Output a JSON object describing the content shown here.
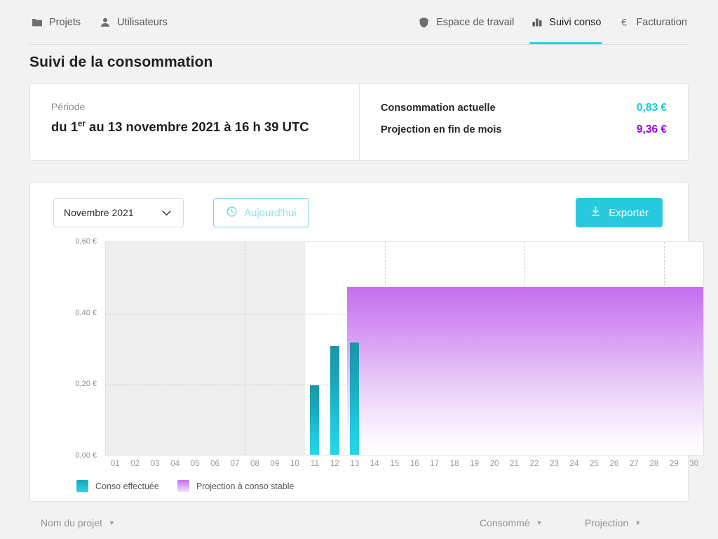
{
  "nav": {
    "left": [
      {
        "label": "Projets",
        "icon": "folder-icon"
      },
      {
        "label": "Utilisateurs",
        "icon": "user-icon"
      }
    ],
    "right": [
      {
        "label": "Espace de travail",
        "icon": "shield-icon",
        "active": false
      },
      {
        "label": "Suivi conso",
        "icon": "bar-chart-icon",
        "active": true
      },
      {
        "label": "Facturation",
        "icon": "euro-icon",
        "active": false
      }
    ],
    "active_underline_color": "#29d3e3"
  },
  "page": {
    "title": "Suivi de la consommation"
  },
  "summary": {
    "period_label": "Période",
    "period_prefix": "du 1",
    "period_sup": "er",
    "period_rest": " au 13 novembre 2021 à 16 h 39 UTC",
    "stats": [
      {
        "label": "Consommation actuelle",
        "value": "0,83 €",
        "color": "#18c8dd"
      },
      {
        "label": "Projection en fin de mois",
        "value": "9,36 €",
        "color": "#9a00d8"
      }
    ]
  },
  "toolbar": {
    "month_select": "Novembre 2021",
    "today_button": "Aujourd'hui",
    "export_button": "Exporter",
    "chevron_icon": "chevron-down-icon",
    "history_icon": "clock-rewind-icon",
    "download_icon": "download-icon"
  },
  "legend": [
    {
      "label": "Conso effectuée",
      "color": "#1fbed2"
    },
    {
      "label": "Projection à conso stable",
      "color": "#c071ef"
    }
  ],
  "table": {
    "columns": [
      {
        "label": "Nom du projet",
        "sort_icon": "sort-caret-icon"
      },
      {
        "label": "Consommé",
        "sort_icon": "sort-caret-icon"
      },
      {
        "label": "Projection",
        "sort_icon": "sort-caret-icon"
      }
    ]
  },
  "chart_data": {
    "type": "bar",
    "title": "",
    "xlabel": "",
    "ylabel": "",
    "categories": [
      "01",
      "02",
      "03",
      "04",
      "05",
      "06",
      "07",
      "08",
      "09",
      "10",
      "11",
      "12",
      "13",
      "14",
      "15",
      "16",
      "17",
      "18",
      "19",
      "20",
      "21",
      "22",
      "23",
      "24",
      "25",
      "26",
      "27",
      "28",
      "29",
      "30"
    ],
    "series": [
      {
        "name": "Conso effectuée",
        "color": "#1fbed2",
        "values": [
          null,
          null,
          null,
          null,
          null,
          null,
          null,
          null,
          null,
          null,
          0.195,
          0.305,
          0.315,
          null,
          null,
          null,
          null,
          null,
          null,
          null,
          null,
          null,
          null,
          null,
          null,
          null,
          null,
          null,
          null,
          null
        ]
      },
      {
        "name": "Projection à conso stable",
        "color": "#c071ef",
        "type": "area",
        "values": [
          null,
          null,
          null,
          null,
          null,
          null,
          null,
          null,
          null,
          null,
          null,
          null,
          0.47,
          0.47,
          0.47,
          0.47,
          0.47,
          0.47,
          0.47,
          0.47,
          0.47,
          0.47,
          0.47,
          0.47,
          0.47,
          0.47,
          0.47,
          0.47,
          0.47,
          0.47
        ]
      }
    ],
    "ylim": [
      0,
      0.6
    ],
    "yticks": [
      0,
      0.2,
      0.4,
      0.6
    ],
    "ytick_labels": [
      "0,00 €",
      "0,20 €",
      "0,40 €",
      "0,60 €"
    ],
    "grid": "horizontal-dashed-and-vertical-dashed",
    "legend_position": "bottom-left",
    "no_data_region": {
      "from": "01",
      "to": "10",
      "color": "#eeeeee"
    }
  }
}
